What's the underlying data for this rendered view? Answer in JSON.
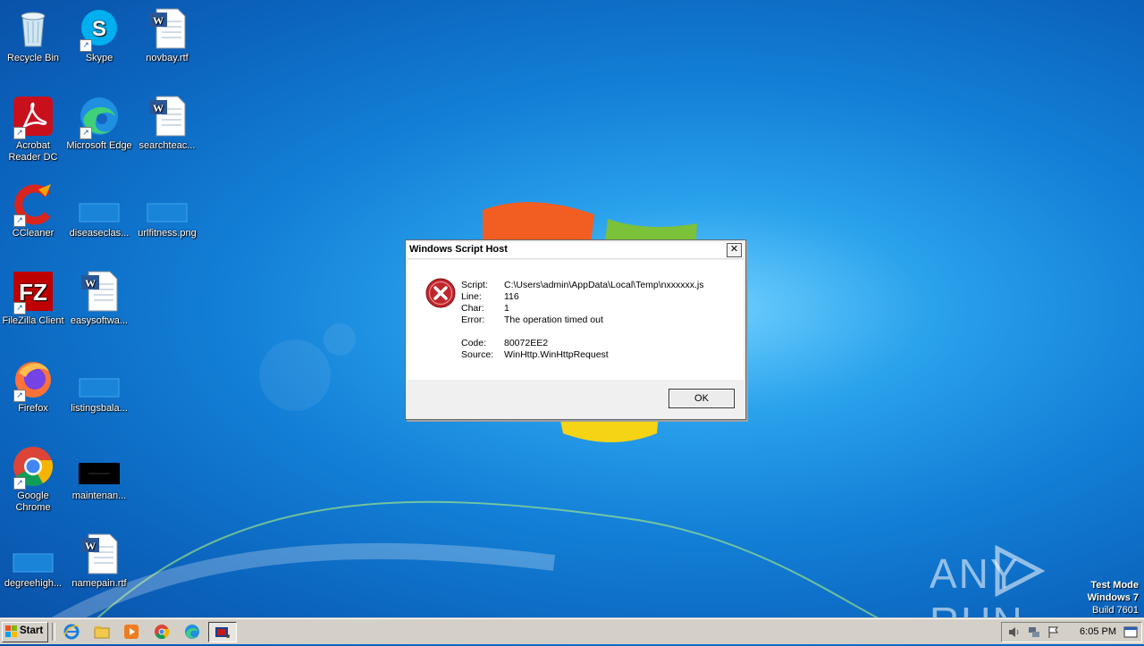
{
  "desktop": {
    "icons": [
      {
        "label": "Recycle Bin"
      },
      {
        "label": "Skype"
      },
      {
        "label": "novbay.rtf"
      },
      {
        "label": "Acrobat Reader DC"
      },
      {
        "label": "Microsoft Edge"
      },
      {
        "label": "searchteac..."
      },
      {
        "label": "CCleaner"
      },
      {
        "label": "diseaseclas..."
      },
      {
        "label": "urlfitness.png"
      },
      {
        "label": "FileZilla Client"
      },
      {
        "label": "easysoftwa..."
      },
      {
        "label": "Firefox"
      },
      {
        "label": "listingsbala..."
      },
      {
        "label": "Google Chrome"
      },
      {
        "label": "maintenan..."
      },
      {
        "label": "degreehigh..."
      },
      {
        "label": "namepain.rtf"
      }
    ]
  },
  "dialog": {
    "title": "Windows Script Host",
    "close_glyph": "✕",
    "fields": [
      {
        "key": "Script:",
        "value": "C:\\Users\\admin\\AppData\\Local\\Temp\\nxxxxxx.js"
      },
      {
        "key": "Line:",
        "value": "116"
      },
      {
        "key": "Char:",
        "value": "1"
      },
      {
        "key": "Error:",
        "value": "The operation timed out"
      },
      {
        "key": "Code:",
        "value": "80072EE2"
      },
      {
        "key": "Source:",
        "value": "WinHttp.WinHttpRequest"
      }
    ],
    "ok_label": "OK"
  },
  "watermark": {
    "text": "ANY RUN"
  },
  "os_info": {
    "line1": "Test Mode",
    "line2": "Windows 7",
    "line3": "Build 7601"
  },
  "taskbar": {
    "start_label": "Start",
    "clock": "6:05 PM"
  }
}
